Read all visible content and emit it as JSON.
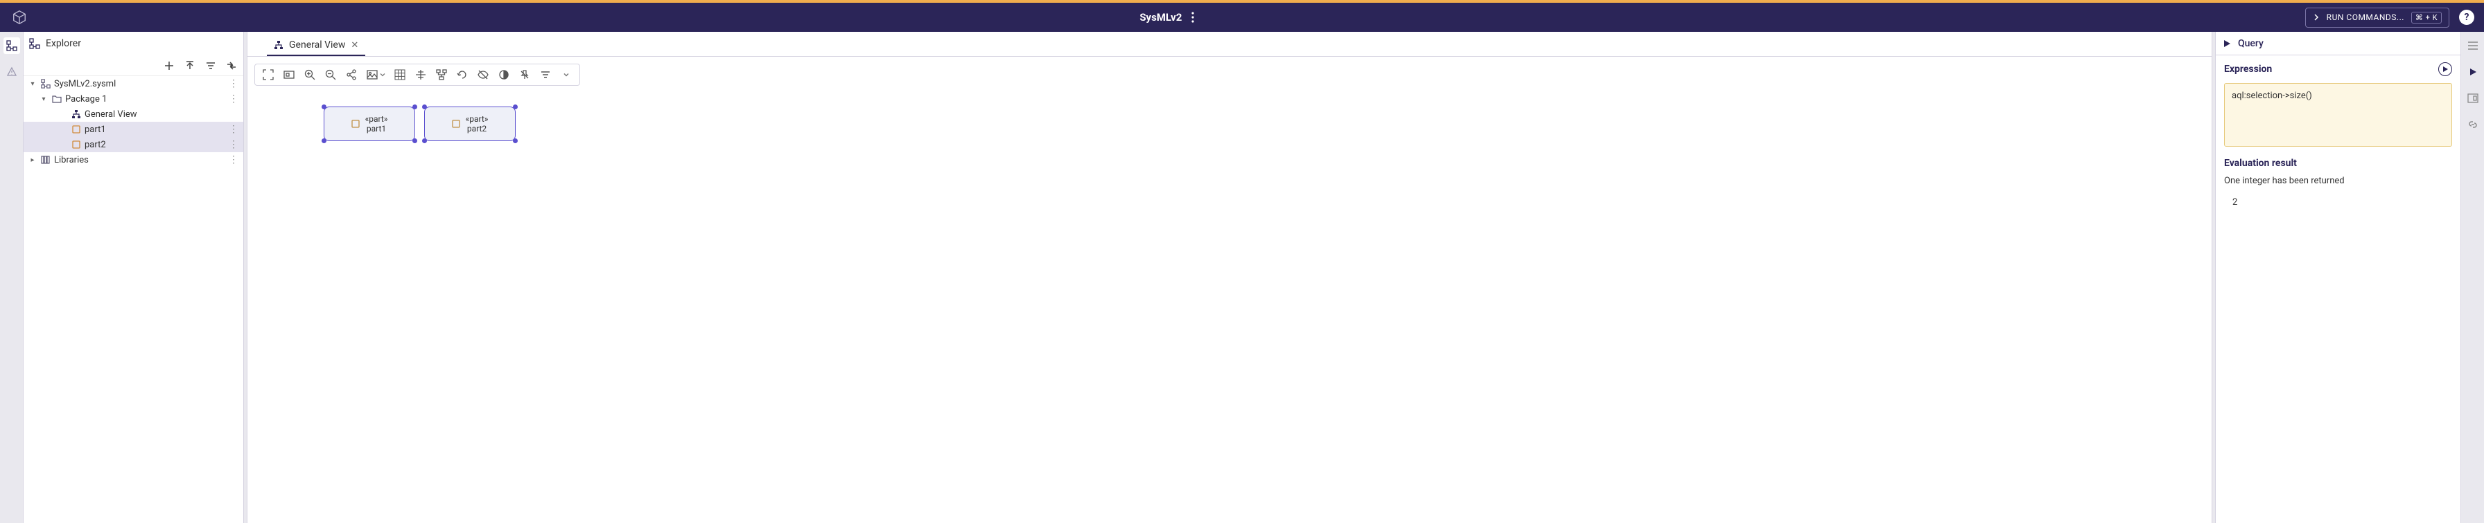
{
  "topbar": {
    "title": "SysMLv2",
    "run_commands_label": "RUN COMMANDS...",
    "run_commands_kbd": "⌘ + K"
  },
  "explorer": {
    "title": "Explorer",
    "tree": {
      "root_label": "SysMLv2.sysml",
      "package_label": "Package 1",
      "general_view_label": "General View",
      "part1_label": "part1",
      "part2_label": "part2",
      "libraries_label": "Libraries"
    }
  },
  "canvas": {
    "tab_label": "General View",
    "part_stereotype": "«part»",
    "part1_name": "part1",
    "part2_name": "part2"
  },
  "query": {
    "title": "Query",
    "expression_title": "Expression",
    "expression_value": "aql:selection->size()",
    "eval_title": "Evaluation result",
    "eval_message": "One integer has been returned",
    "eval_value": "2"
  }
}
